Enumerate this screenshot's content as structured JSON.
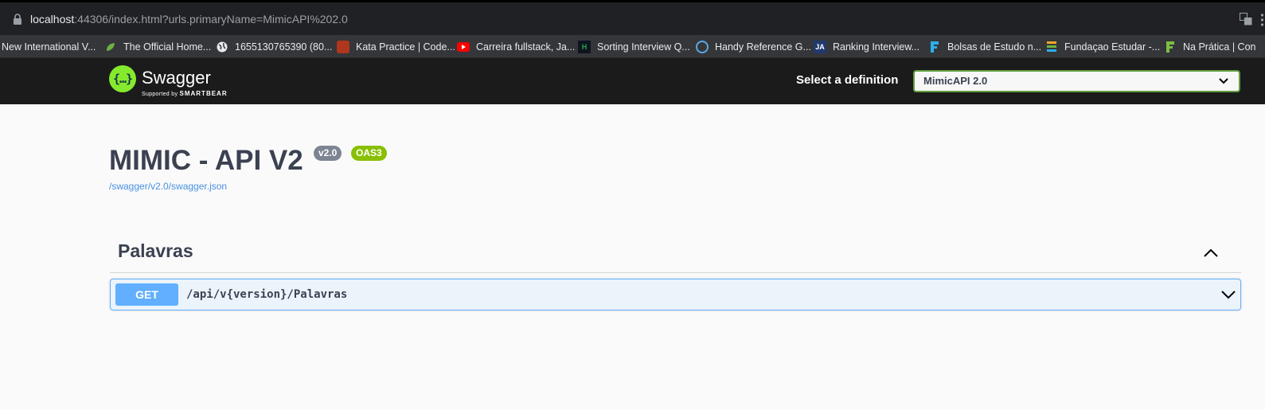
{
  "browser": {
    "url_host": "localhost",
    "url_rest": ":44306/index.html?urls.primaryName=MimicAPI%202.0",
    "bookmarks": [
      {
        "label": "New International V...",
        "icon": "none",
        "color": ""
      },
      {
        "label": "The Official Home...",
        "icon": "spring-icon",
        "color": "#6db33f"
      },
      {
        "label": "1655130765390 (80...",
        "icon": "globe-icon",
        "color": "#e8eaed"
      },
      {
        "label": "Kata Practice | Code...",
        "icon": "codewars-icon",
        "color": "#b1361e"
      },
      {
        "label": "Carreira fullstack, Ja...",
        "icon": "youtube-icon",
        "color": "#ff0000"
      },
      {
        "label": "Sorting Interview Q...",
        "icon": "hackerrank-icon",
        "color": "#1ba94c"
      },
      {
        "label": "Handy Reference G...",
        "icon": "reference-icon",
        "color": "#5aa9e6"
      },
      {
        "label": "Ranking Interview...",
        "icon": "ja-icon",
        "color": "#1f3a6e"
      },
      {
        "label": "Bolsas de Estudo n...",
        "icon": "f-icon",
        "color": "#2cb0e8"
      },
      {
        "label": "Fundaçao Estudar -...",
        "icon": "stripes-icon",
        "color": "#f5a623"
      },
      {
        "label": "Na Prática | Con",
        "icon": "f-icon",
        "color": "#7dbf42"
      }
    ]
  },
  "topbar": {
    "logo_text": "Swagger",
    "logo_sub": "Supported by",
    "logo_sub_brand": "SMARTBEAR",
    "select_label": "Select a definition",
    "select_value": "MimicAPI 2.0"
  },
  "info": {
    "title": "MIMIC - API V2",
    "version": "v2.0",
    "oas": "OAS3",
    "spec_url": "/swagger/v2.0/swagger.json"
  },
  "tags": [
    {
      "name": "Palavras",
      "operations": [
        {
          "method": "GET",
          "path": "/api/v{version}/Palavras"
        }
      ]
    }
  ]
}
